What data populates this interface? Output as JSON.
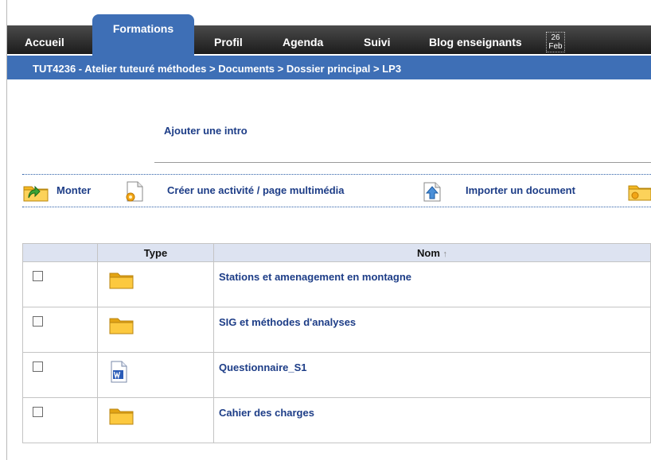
{
  "nav": {
    "items": [
      {
        "label": "Accueil",
        "active": false
      },
      {
        "label": "Formations",
        "active": true
      },
      {
        "label": "Profil",
        "active": false
      },
      {
        "label": "Agenda",
        "active": false
      },
      {
        "label": "Suivi",
        "active": false
      },
      {
        "label": "Blog enseignants",
        "active": false
      }
    ],
    "date_day": "26",
    "date_month": "Feb"
  },
  "breadcrumb": {
    "items": [
      "TUT4236 - Atelier tuteuré méthodes",
      "Documents",
      "Dossier principal",
      "LP3"
    ],
    "separator": ">"
  },
  "intro": {
    "link": "Ajouter une intro"
  },
  "toolbar": {
    "up": "Monter",
    "create": "Créer une activité / page multimédia",
    "import": "Importer un document"
  },
  "table": {
    "headers": {
      "type": "Type",
      "name": "Nom",
      "sort_indicator": "↑"
    },
    "rows": [
      {
        "type_icon": "folder-icon",
        "name": "Stations et amenagement en montagne",
        "checked": false
      },
      {
        "type_icon": "folder-icon",
        "name": "SIG et méthodes d'analyses",
        "checked": false
      },
      {
        "type_icon": "word-document-icon",
        "name": "Questionnaire_S1",
        "checked": false
      },
      {
        "type_icon": "folder-icon",
        "name": "Cahier des charges",
        "checked": false
      }
    ]
  },
  "colors": {
    "nav_bg": "#2a2a2a",
    "accent_blue": "#3e6fb6",
    "link_blue": "#1d3d87",
    "folder_yellow": "#f5b823",
    "header_bg": "#dde3f1"
  }
}
